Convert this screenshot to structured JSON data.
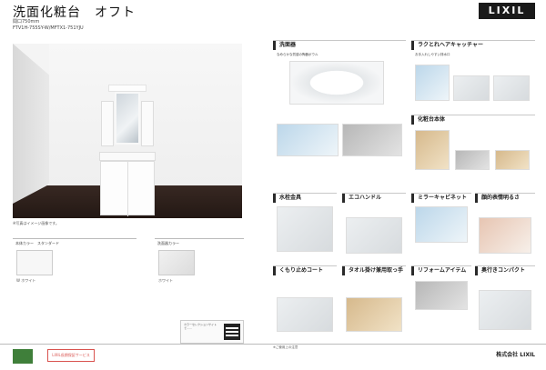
{
  "header": {
    "title": "洗面化粧台　オフト",
    "subtitle": "間口750mm",
    "model": "FTV1H-755SY-W/MFTX1-751YJU",
    "logo": "LIXIL"
  },
  "photo": {
    "caption": "※写真はイメージ画像です。"
  },
  "colors": {
    "body_label": "本体カラー　スタンダード",
    "body_code": "W\nホワイト",
    "bowl_label": "洗面器カラー",
    "bowl_code": "ホワイト"
  },
  "qr": {
    "text": "カラーセレクションサイトで……"
  },
  "features": {
    "bowl": {
      "title": "洗面器",
      "desc": "なめらかな質感の陶器ボウル"
    },
    "catcher": {
      "title": "ラクとれヘアキャッチャー",
      "desc": "お手入れしやすい排水口"
    },
    "cabinet": {
      "title": "化粧台本体",
      "desc": ""
    },
    "faucet": {
      "title": "水栓金具",
      "desc": ""
    },
    "eco": {
      "title": "エコハンドル",
      "desc": ""
    },
    "mirror": {
      "title": "ミラーキャビネット",
      "desc": ""
    },
    "light": {
      "title": "顔的表情明るさ",
      "desc": ""
    },
    "coat": {
      "title": "くもり止めコート",
      "desc": ""
    },
    "towel": {
      "title": "タオル掛け兼用取っ手",
      "desc": ""
    },
    "reform": {
      "title": "リフォームアイテム",
      "desc": ""
    },
    "compact": {
      "title": "奥行きコンパクト",
      "desc": ""
    }
  },
  "footer": {
    "note": "※ご使用上の注意",
    "doc_id": "",
    "company": "株式会社 LIXIL",
    "badge2": "LIXIL長期保証サービス"
  }
}
